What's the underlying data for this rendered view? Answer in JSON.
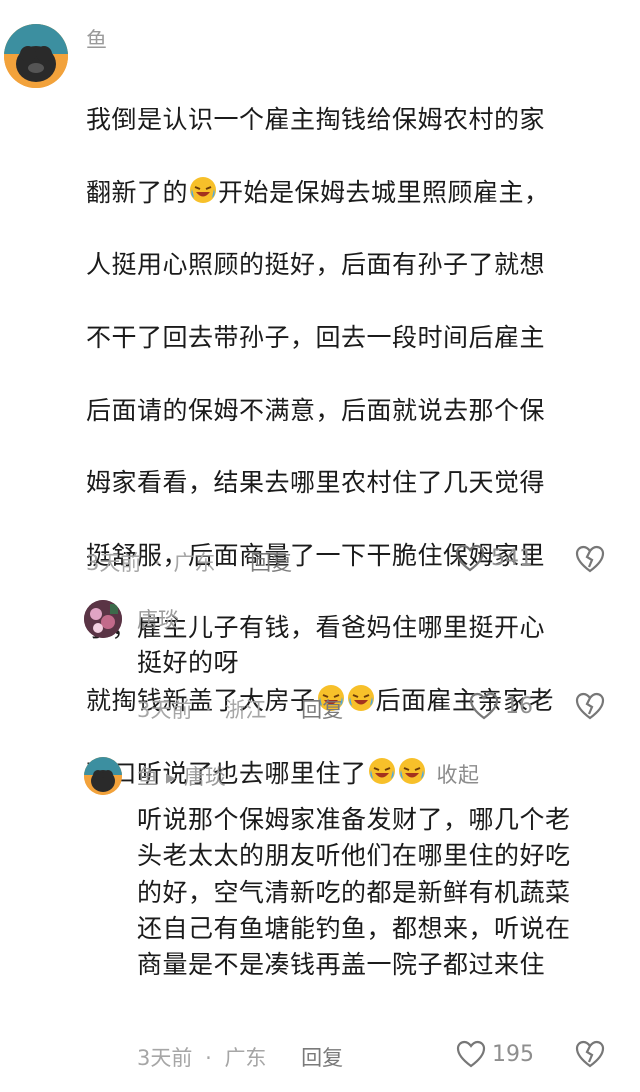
{
  "comments": [
    {
      "username": "鱼",
      "text_lines": [
        "我倒是认识一个雇主掏钱给保姆农村的家",
        "翻新了的",
        "开始是保姆去城里照顾雇主，",
        "人挺用心照顾的挺好，后面有孙子了就想",
        "不干了回去带孙子，回去一段时间后雇主",
        "后面请的保姆不满意，后面就说去那个保",
        "姆家看看，结果去哪里农村住了几天觉得",
        "挺舒服，后面商量了一下干脆住保姆家里",
        "了，雇主儿子有钱，看爸妈住哪里挺开心",
        "就掏钱新盖了大房子",
        "后面雇主亲家老",
        "两口听说了也去哪里住了"
      ],
      "collapse_label": "收起",
      "time": "3天前",
      "location": "广东",
      "reply_label": "回复",
      "likes": "541"
    },
    {
      "username": "唐琰",
      "text": "挺好的呀",
      "time": "3天前",
      "location": "浙江",
      "reply_label": "回复",
      "likes": "16"
    },
    {
      "username": "鱼",
      "reply_to": "唐琰",
      "text": "听说那个保姆家准备发财了，哪几个老\n头老太太的朋友听他们在哪里住的好吃\n的好，空气清新吃的都是新鲜有机蔬菜\n还自己有鱼塘能钓鱼，都想来，听说在\n商量是不是凑钱再盖一院子都过来住",
      "time": "3天前",
      "location": "广东",
      "reply_label": "回复",
      "likes": "195"
    }
  ],
  "separator": "·",
  "icons": {
    "like": "heart-outline-icon",
    "dislike": "broken-heart-icon",
    "emoji": "laughing-crying-emoji",
    "reply_arrow": "right-triangle-icon"
  }
}
